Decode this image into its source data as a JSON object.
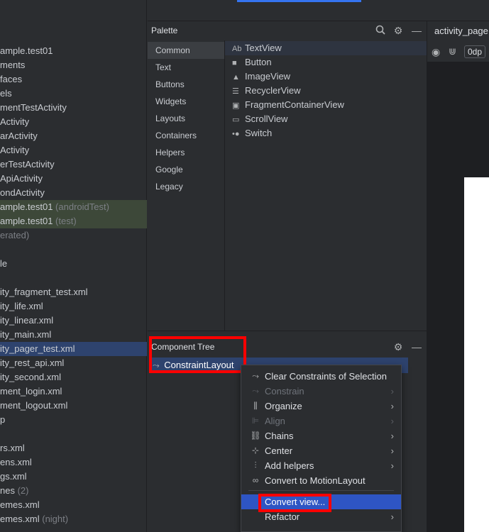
{
  "project": {
    "rows": [
      {
        "text": "ample.test01",
        "suffix": "",
        "style": "normal"
      },
      {
        "text": "ments",
        "suffix": "",
        "style": "normal"
      },
      {
        "text": "faces",
        "suffix": "",
        "style": "normal"
      },
      {
        "text": "els",
        "suffix": "",
        "style": "normal"
      },
      {
        "text": "mentTestActivity",
        "suffix": "",
        "style": "normal"
      },
      {
        "text": "Activity",
        "suffix": "",
        "style": "normal"
      },
      {
        "text": "arActivity",
        "suffix": "",
        "style": "normal"
      },
      {
        "text": "Activity",
        "suffix": "",
        "style": "normal"
      },
      {
        "text": "erTestActivity",
        "suffix": "",
        "style": "normal"
      },
      {
        "text": "ApiActivity",
        "suffix": "",
        "style": "normal"
      },
      {
        "text": "ondActivity",
        "suffix": "",
        "style": "normal"
      },
      {
        "text": "ample.test01",
        "suffix": " (androidTest)",
        "style": "test"
      },
      {
        "text": "ample.test01",
        "suffix": " (test)",
        "style": "test"
      },
      {
        "text": "",
        "suffix": "erated)",
        "style": "normal"
      },
      {
        "text": "",
        "suffix": "",
        "style": "normal"
      },
      {
        "text": "le",
        "suffix": "",
        "style": "normal"
      },
      {
        "text": "",
        "suffix": "",
        "style": "normal"
      },
      {
        "text": "ity_fragment_test.xml",
        "suffix": "",
        "style": "normal"
      },
      {
        "text": "ity_life.xml",
        "suffix": "",
        "style": "normal"
      },
      {
        "text": "ity_linear.xml",
        "suffix": "",
        "style": "normal"
      },
      {
        "text": "ity_main.xml",
        "suffix": "",
        "style": "normal"
      },
      {
        "text": "ity_pager_test.xml",
        "suffix": "",
        "style": "sel"
      },
      {
        "text": "ity_rest_api.xml",
        "suffix": "",
        "style": "normal"
      },
      {
        "text": "ity_second.xml",
        "suffix": "",
        "style": "normal"
      },
      {
        "text": "ment_login.xml",
        "suffix": "",
        "style": "normal"
      },
      {
        "text": "ment_logout.xml",
        "suffix": "",
        "style": "normal"
      },
      {
        "text": "p",
        "suffix": "",
        "style": "normal"
      },
      {
        "text": "",
        "suffix": "",
        "style": "normal"
      },
      {
        "text": "rs.xml",
        "suffix": "",
        "style": "normal"
      },
      {
        "text": "ens.xml",
        "suffix": "",
        "style": "normal"
      },
      {
        "text": "gs.xml",
        "suffix": "",
        "style": "normal"
      },
      {
        "text": "nes",
        "suffix": " (2)",
        "style": "normal"
      },
      {
        "text": "emes.xml",
        "suffix": "",
        "style": "normal"
      },
      {
        "text": "emes.xml",
        "suffix": " (night)",
        "style": "normal"
      }
    ]
  },
  "palette": {
    "title": "Palette",
    "categories": [
      "Common",
      "Text",
      "Buttons",
      "Widgets",
      "Layouts",
      "Containers",
      "Helpers",
      "Google",
      "Legacy"
    ],
    "items": [
      {
        "icon": "Ab",
        "label": "TextView"
      },
      {
        "icon": "■",
        "label": "Button"
      },
      {
        "icon": "▲",
        "label": "ImageView"
      },
      {
        "icon": "☰",
        "label": "RecyclerView"
      },
      {
        "icon": "▣",
        "label": "FragmentContainerView"
      },
      {
        "icon": "▭",
        "label": "ScrollView"
      },
      {
        "icon": "•●",
        "label": "Switch"
      }
    ]
  },
  "component_tree": {
    "title": "Component Tree",
    "root": "ConstraintLayout"
  },
  "design": {
    "tab_title": "activity_page",
    "margin_value": "0dp"
  },
  "context_menu": {
    "items": [
      {
        "label": "Clear Constraints of Selection",
        "icon": "clear-constraints-icon",
        "glyph": "⤳",
        "disabled": false,
        "submenu": false
      },
      {
        "label": "Constrain",
        "icon": "constrain-icon",
        "glyph": "⤳",
        "disabled": true,
        "submenu": true
      },
      {
        "label": "Organize",
        "icon": "organize-icon",
        "glyph": "⫼",
        "disabled": false,
        "submenu": true
      },
      {
        "label": "Align",
        "icon": "align-icon",
        "glyph": "⊫",
        "disabled": true,
        "submenu": true
      },
      {
        "label": "Chains",
        "icon": "chains-icon",
        "glyph": "⛓",
        "disabled": false,
        "submenu": true
      },
      {
        "label": "Center",
        "icon": "center-icon",
        "glyph": "⊹",
        "disabled": false,
        "submenu": true
      },
      {
        "label": "Add helpers",
        "icon": "add-helpers-icon",
        "glyph": "⫶",
        "disabled": false,
        "submenu": true
      },
      {
        "label": "Convert to MotionLayout",
        "icon": "motion-layout-icon",
        "glyph": "∞",
        "disabled": false,
        "submenu": false
      },
      {
        "label": "Convert view...",
        "icon": "",
        "glyph": "",
        "disabled": false,
        "submenu": false,
        "highlighted": true
      },
      {
        "label": "Refactor",
        "icon": "",
        "glyph": "",
        "disabled": false,
        "submenu": true
      }
    ]
  },
  "colors": {
    "accent": "#3574f0",
    "highlight": "#2e55c4",
    "annotation_box": "#ff0000"
  }
}
